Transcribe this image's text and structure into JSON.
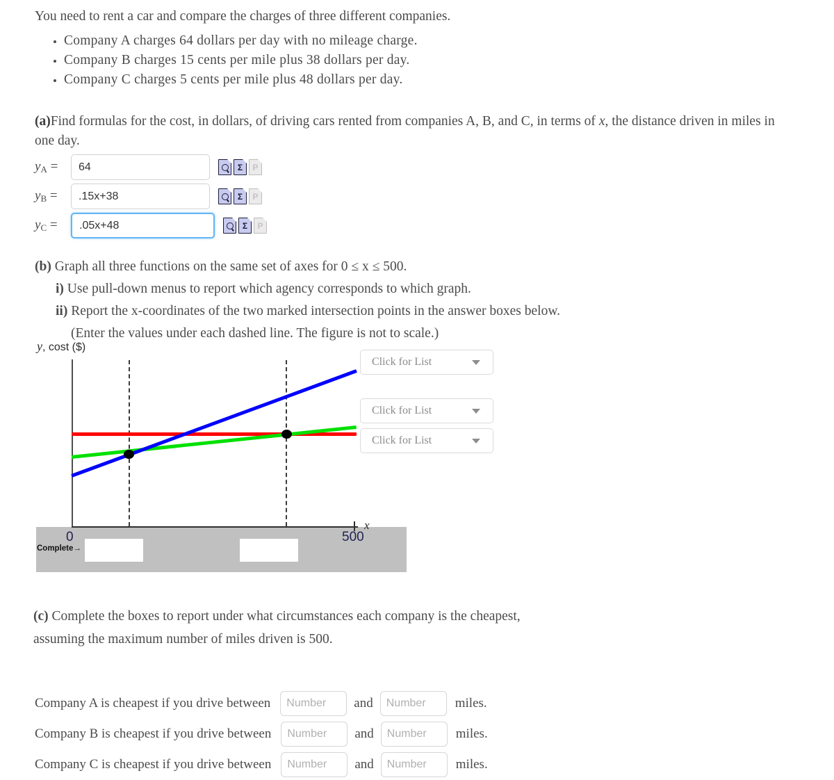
{
  "intro": {
    "lead": "You need to rent a car and compare the charges of three different companies.",
    "bullets": [
      "Company A charges 64  dollars  per  day  with  no  mileage  charge.",
      "Company B charges 15  cents  per  mile  plus  38  dollars  per  day.",
      "Company C charges 5  cents  per  mile  plus  48  dollars  per  day."
    ]
  },
  "part_a": {
    "label": "(a)",
    "text_1": "Find formulas for the cost, in dollars, of driving cars rented from companies A, B, and C, in terms of ",
    "text_x": "x",
    "text_2": ", the distance driven in miles in one day.",
    "rows": [
      {
        "label_y": "y",
        "label_sub": "A",
        "label_eq": "=",
        "value": "64",
        "focused": false
      },
      {
        "label_y": "y",
        "label_sub": "B",
        "label_eq": "=",
        "value": ".15x+38",
        "focused": false
      },
      {
        "label_y": "y",
        "label_sub": "C",
        "label_eq": "=",
        "value": ".05x+48",
        "focused": true
      }
    ],
    "icons": [
      "preview-icon",
      "sigma-icon",
      "plot-icon-disabled"
    ],
    "sigma_glyph": "Σ",
    "plot_glyph": "P"
  },
  "part_b": {
    "label": "(b)",
    "line_1": "Graph all three functions on the same set of axes for 0 ≤ x  ≤ 500.",
    "line_2_label": "i)",
    "line_2": "Use pull-down menus to report which agency corresponds to which graph.",
    "line_3_label": "ii)",
    "line_3": "Report the x-coordinates of the two marked intersection points in the answer boxes below.",
    "line_4": "(Enter the values under each dashed line. The figure is not to scale.)"
  },
  "figure": {
    "y_axis_label_y": "y",
    "y_axis_label_rest": ", cost ($)",
    "x_axis_label": "x",
    "tick_zero": "0",
    "tick_500": "500",
    "complete_label": "Complete→",
    "answer_box_1": "",
    "answer_box_2": "",
    "band_color": "#c0c0c0"
  },
  "chart_data": {
    "type": "line",
    "title": "",
    "xlabel": "x",
    "ylabel": "y, cost ($)",
    "xlim": [
      0,
      500
    ],
    "xticks": [
      0,
      500
    ],
    "grid": false,
    "not_to_scale": true,
    "series": [
      {
        "name": "Company A",
        "color": "#ff0000",
        "style": "horizontal",
        "formula": "y = 64",
        "slope": 0,
        "intercept": 64
      },
      {
        "name": "Company B",
        "color": "#0000ff",
        "style": "steep",
        "formula": "y = .15x + 38",
        "slope": 0.15,
        "intercept": 38
      },
      {
        "name": "Company C",
        "color": "#00e000",
        "style": "shallow",
        "formula": "y = .05x + 48",
        "slope": 0.05,
        "intercept": 48
      }
    ],
    "marked_intersections": [
      {
        "label": "B meets C",
        "dashed_line": 1
      },
      {
        "label": "C meets A",
        "dashed_line": 2
      }
    ],
    "dropdowns": [
      "Click for List",
      "Click for List",
      "Click for List"
    ]
  },
  "dropdowns": {
    "placeholder": "Click for List",
    "items": [
      {
        "label": "Click for List"
      },
      {
        "label": "Click for List"
      },
      {
        "label": "Click for List"
      }
    ]
  },
  "part_c": {
    "label": "(c)",
    "line_1": "Complete the boxes to report under what circumstances each company is the cheapest,",
    "line_2": "assuming the maximum number of miles driven is 500."
  },
  "answers": {
    "and_label": "and",
    "miles_label": "miles.",
    "placeholder": "Number",
    "rows": [
      {
        "text": "Company A is cheapest if you drive between",
        "value_1": "",
        "value_2": ""
      },
      {
        "text": "Company B is cheapest if you drive between",
        "value_1": "",
        "value_2": ""
      },
      {
        "text": "Company C is cheapest if you drive between",
        "value_1": "",
        "value_2": ""
      }
    ]
  }
}
